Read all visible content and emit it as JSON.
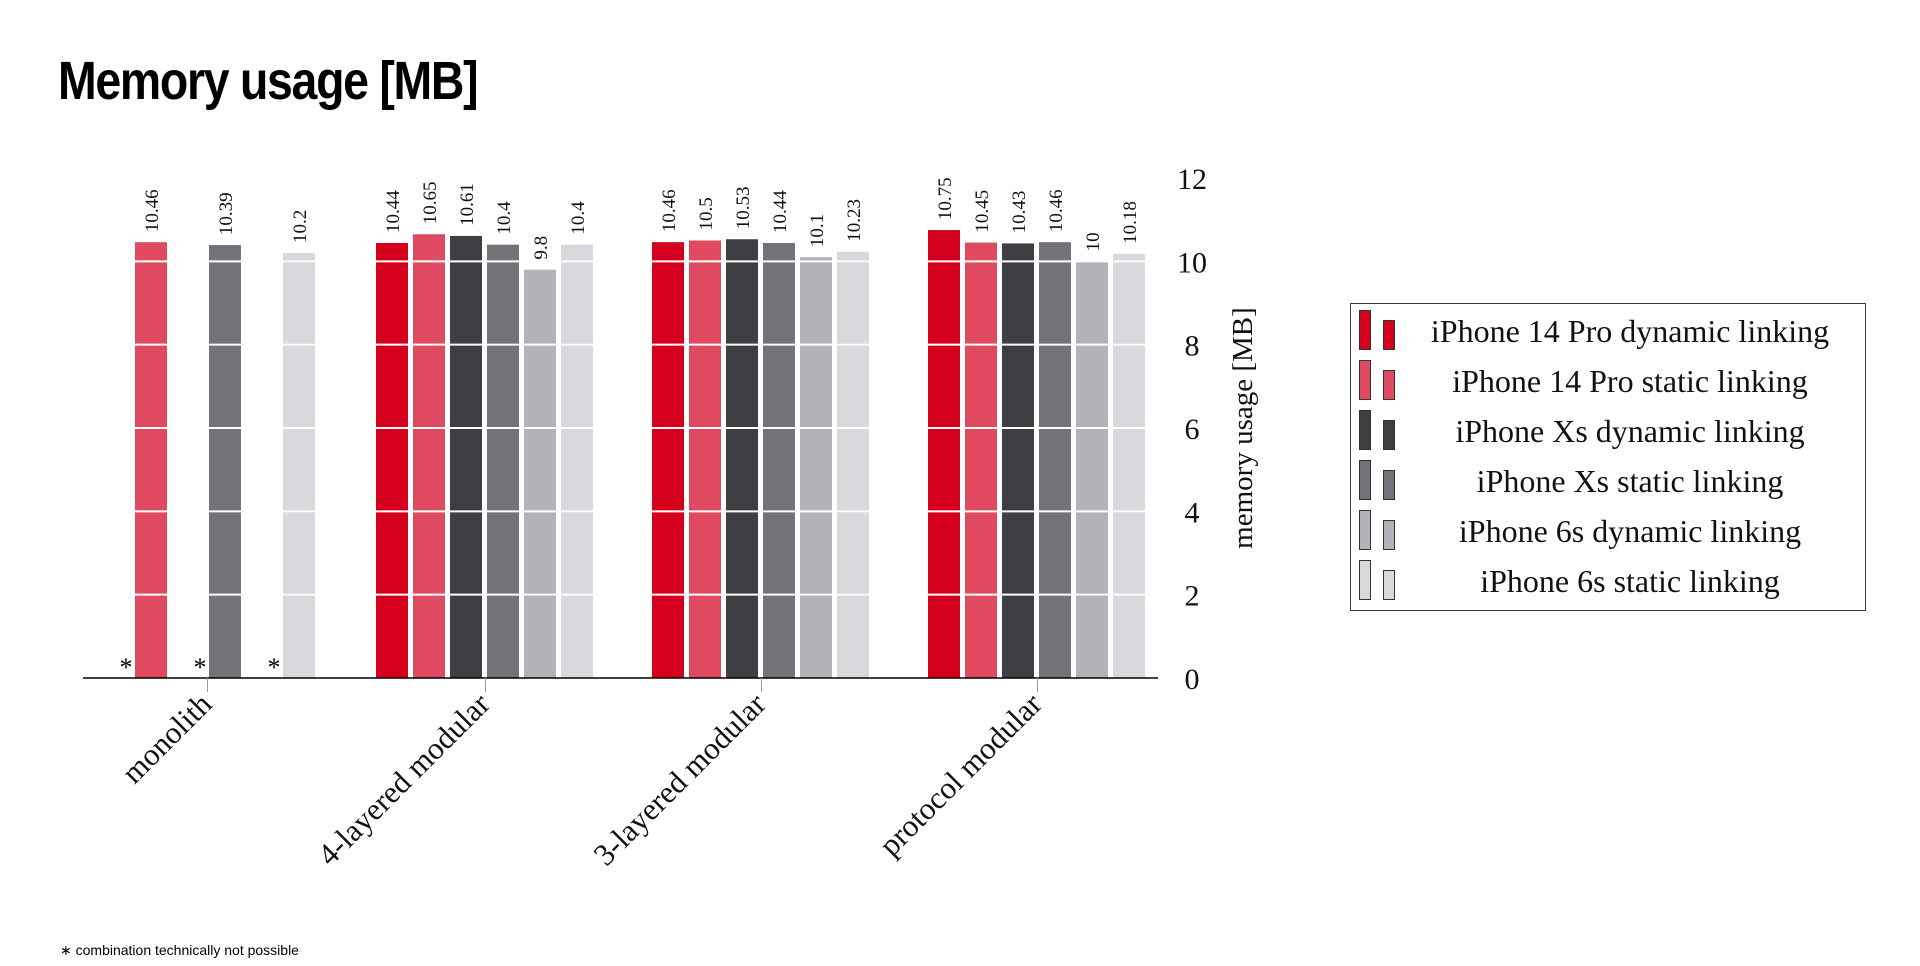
{
  "page": {
    "title": "Memory usage [MB]",
    "footnote": "∗ combination technically not possible"
  },
  "chart_data": {
    "type": "bar",
    "title": "Memory usage [MB]",
    "xlabel": "",
    "ylabel": "memory usage [MB]",
    "ylim": [
      0,
      12
    ],
    "yticks": [
      0,
      2,
      4,
      6,
      8,
      10,
      12
    ],
    "y_axis_side": "right",
    "grid": "horizontal (white lines over bars)",
    "legend_position": "right",
    "categories": [
      "monolith",
      "4-layered modular",
      "3-layered modular",
      "protocol modular"
    ],
    "series": [
      {
        "name": "iPhone 14 Pro dynamic linking",
        "color": "#d5001c",
        "values": [
          null,
          10.44,
          10.46,
          10.75
        ]
      },
      {
        "name": "iPhone 14 Pro static linking",
        "color": "#e04a60",
        "values": [
          10.46,
          10.65,
          10.5,
          10.45
        ]
      },
      {
        "name": "iPhone Xs dynamic linking",
        "color": "#3f3e43",
        "values": [
          null,
          10.61,
          10.53,
          10.43
        ]
      },
      {
        "name": "iPhone Xs static linking",
        "color": "#737278",
        "values": [
          10.39,
          10.4,
          10.44,
          10.46
        ]
      },
      {
        "name": "iPhone 6s dynamic linking",
        "color": "#b3b2b8",
        "values": [
          null,
          9.8,
          10.1,
          10
        ]
      },
      {
        "name": "iPhone 6s static linking",
        "color": "#d8d8dd",
        "values": [
          10.2,
          10.4,
          10.23,
          10.18
        ]
      }
    ],
    "missing_marker": "*",
    "missing_note": "combination technically not possible"
  }
}
